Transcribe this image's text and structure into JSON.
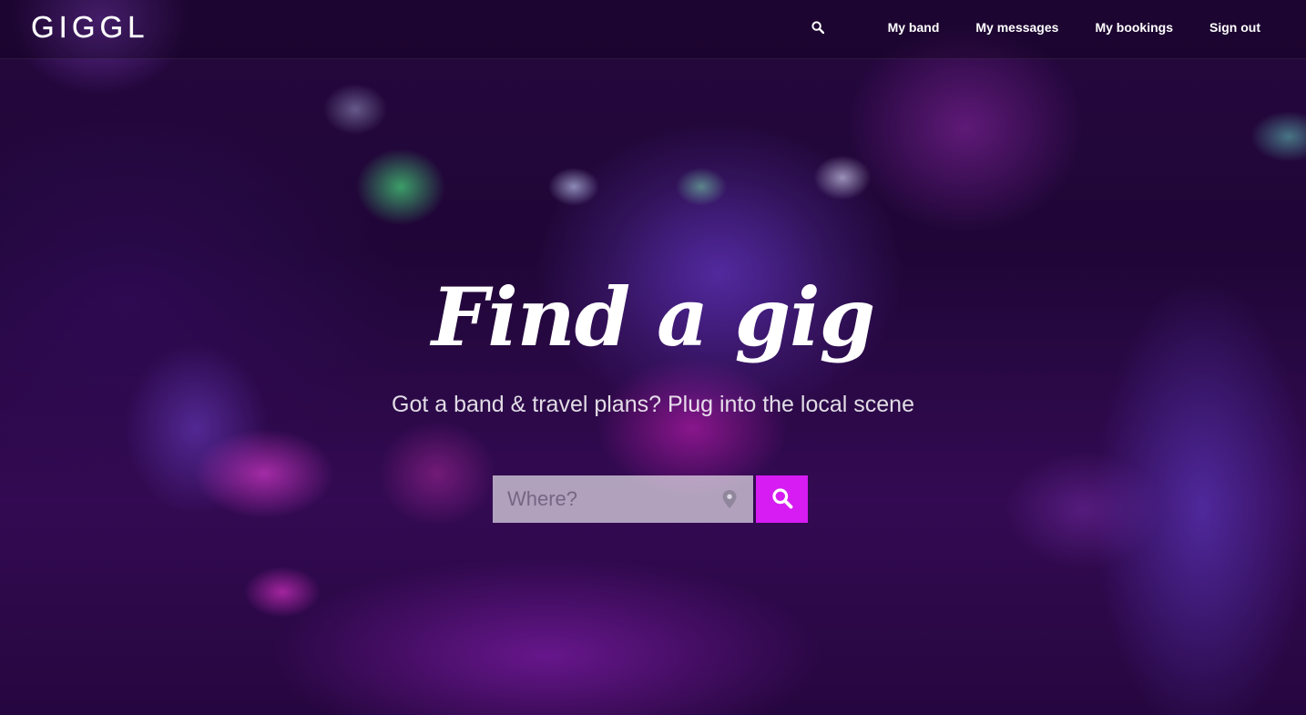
{
  "app": {
    "logo_text": "GIGGL"
  },
  "nav": {
    "search_icon": "search-icon",
    "links": [
      {
        "label": "My band"
      },
      {
        "label": "My messages"
      },
      {
        "label": "My bookings"
      },
      {
        "label": "Sign out"
      }
    ]
  },
  "hero": {
    "title": "Find a gig",
    "subtitle": "Got a band & travel plans? Plug into the local scene",
    "search": {
      "placeholder": "Where?",
      "value": "",
      "location_icon": "map-pin-icon",
      "button_icon": "search-icon"
    }
  },
  "colors": {
    "accent": "#d61cf2",
    "text": "#ffffff"
  }
}
